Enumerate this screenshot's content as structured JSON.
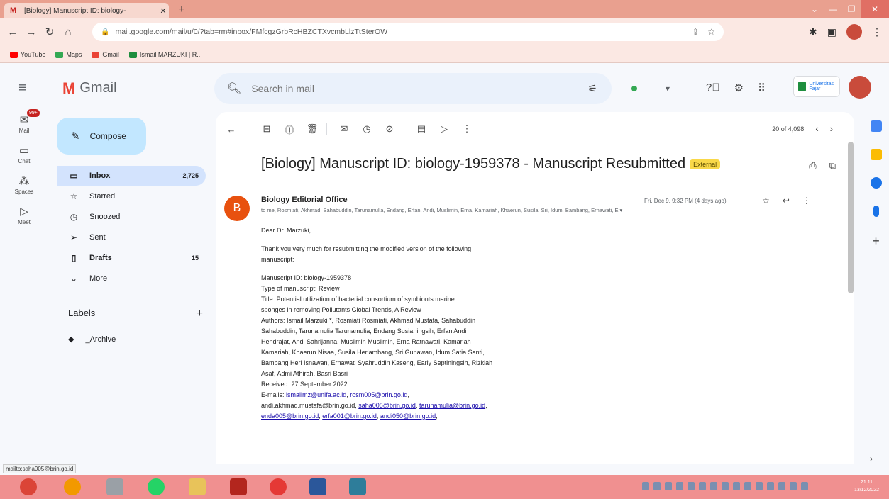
{
  "browser": {
    "tab_title": "[Biology] Manuscript ID: biology-",
    "tab_favicon": "M",
    "address": "mail.google.com/mail/u/0/?tab=rm#inbox/FMfcgzGrbRcHBZCTXvcmbLlzTtSterOW",
    "bookmarks": [
      "YouTube",
      "Maps",
      "Gmail",
      "Ismail MARZUKI | R..."
    ],
    "bookmark_colors": [
      "#ff0000",
      "#34a853",
      "#ea4335",
      "#1e8e3e"
    ]
  },
  "gmail": {
    "logo_text": "Gmail",
    "search_placeholder": "Search in mail",
    "org_badge": "Universitas Fajar",
    "rail": [
      {
        "label": "Mail",
        "icon": "mail-icon",
        "badge": "99+"
      },
      {
        "label": "Chat",
        "icon": "chat-icon"
      },
      {
        "label": "Spaces",
        "icon": "spaces-icon"
      },
      {
        "label": "Meet",
        "icon": "meet-icon"
      }
    ],
    "compose_label": "Compose",
    "nav": [
      {
        "label": "Inbox",
        "icon": "inbox-icon",
        "count": "2,725"
      },
      {
        "label": "Starred",
        "icon": "star-icon",
        "count": ""
      },
      {
        "label": "Snoozed",
        "icon": "snooze-icon",
        "count": ""
      },
      {
        "label": "Sent",
        "icon": "sent-icon",
        "count": ""
      },
      {
        "label": "Drafts",
        "icon": "draft-icon",
        "count": "15"
      },
      {
        "label": "More",
        "icon": "chevron-down-icon",
        "count": ""
      }
    ],
    "labels_heading": "Labels",
    "labels": [
      "_Archive"
    ]
  },
  "message": {
    "pager": "20 of 4,098",
    "subject": "[Biology] Manuscript ID: biology-1959378 - Manuscript Resubmitted",
    "external_badge": "External",
    "sender_initial": "B",
    "sender": "Biology Editorial Office",
    "to_line": "to me, Rosmiati, Akhmad, Sahabuddin, Tarunamulia, Endang, Erfan, Andi, Muslimin, Erna, Kamariah, Khaerun, Susila, Sri, Idum, Bambang, Ernawati, E",
    "date": "Fri, Dec 9, 9:32 PM (4 days ago)",
    "greeting": "Dear Dr. Marzuki,",
    "para1": [
      "Thank you very much for resubmitting the modified version of the following",
      "manuscript:"
    ],
    "details": [
      "Manuscript ID: biology-1959378",
      "Type of manuscript: Review",
      "Title: Potential utilization of bacterial consortium of symbionts marine",
      "sponges in removing Pollutants Global Trends, A Review",
      "Authors: Ismail Marzuki *, Rosmiati Rosmiati, Akhmad Mustafa, Sahabuddin",
      "Sahabuddin, Tarunamulia Tarunamulia, Endang Susianingsih, Erfan Andi",
      "Hendrajat, Andi Sahrijanna, Muslimin Muslimin, Erna Ratnawati, Kamariah",
      "Kamariah, Khaerun Nisaa, Susila Herlambang, Sri Gunawan, Idum Satia Santi,",
      "Bambang Heri Isnawan, Ernawati Syahruddin Kaseng, Early Septiningsih, Rizkiah",
      "Asaf, Admi Athirah, Basri Basri",
      "Received: 27 September 2022"
    ],
    "emails_label": "E-mails:",
    "emails_line1": [
      "ismailmz@unifa.ac.id",
      "rosm005@brin.go.id"
    ],
    "emails_line2_prefix": "andi.akhmad.mustafa@brin.go.id,",
    "emails_line2": [
      "saha005@brin.go.id",
      "tarunamulia@brin.go.id"
    ],
    "emails_line3": [
      "enda005@brin.go.id",
      "erfa001@brin.go.id",
      "andi050@brin.go.id"
    ]
  },
  "status_url": "mailto:saha005@brin.go.id",
  "clock": {
    "time": "21:11",
    "date": "13/12/2022"
  }
}
